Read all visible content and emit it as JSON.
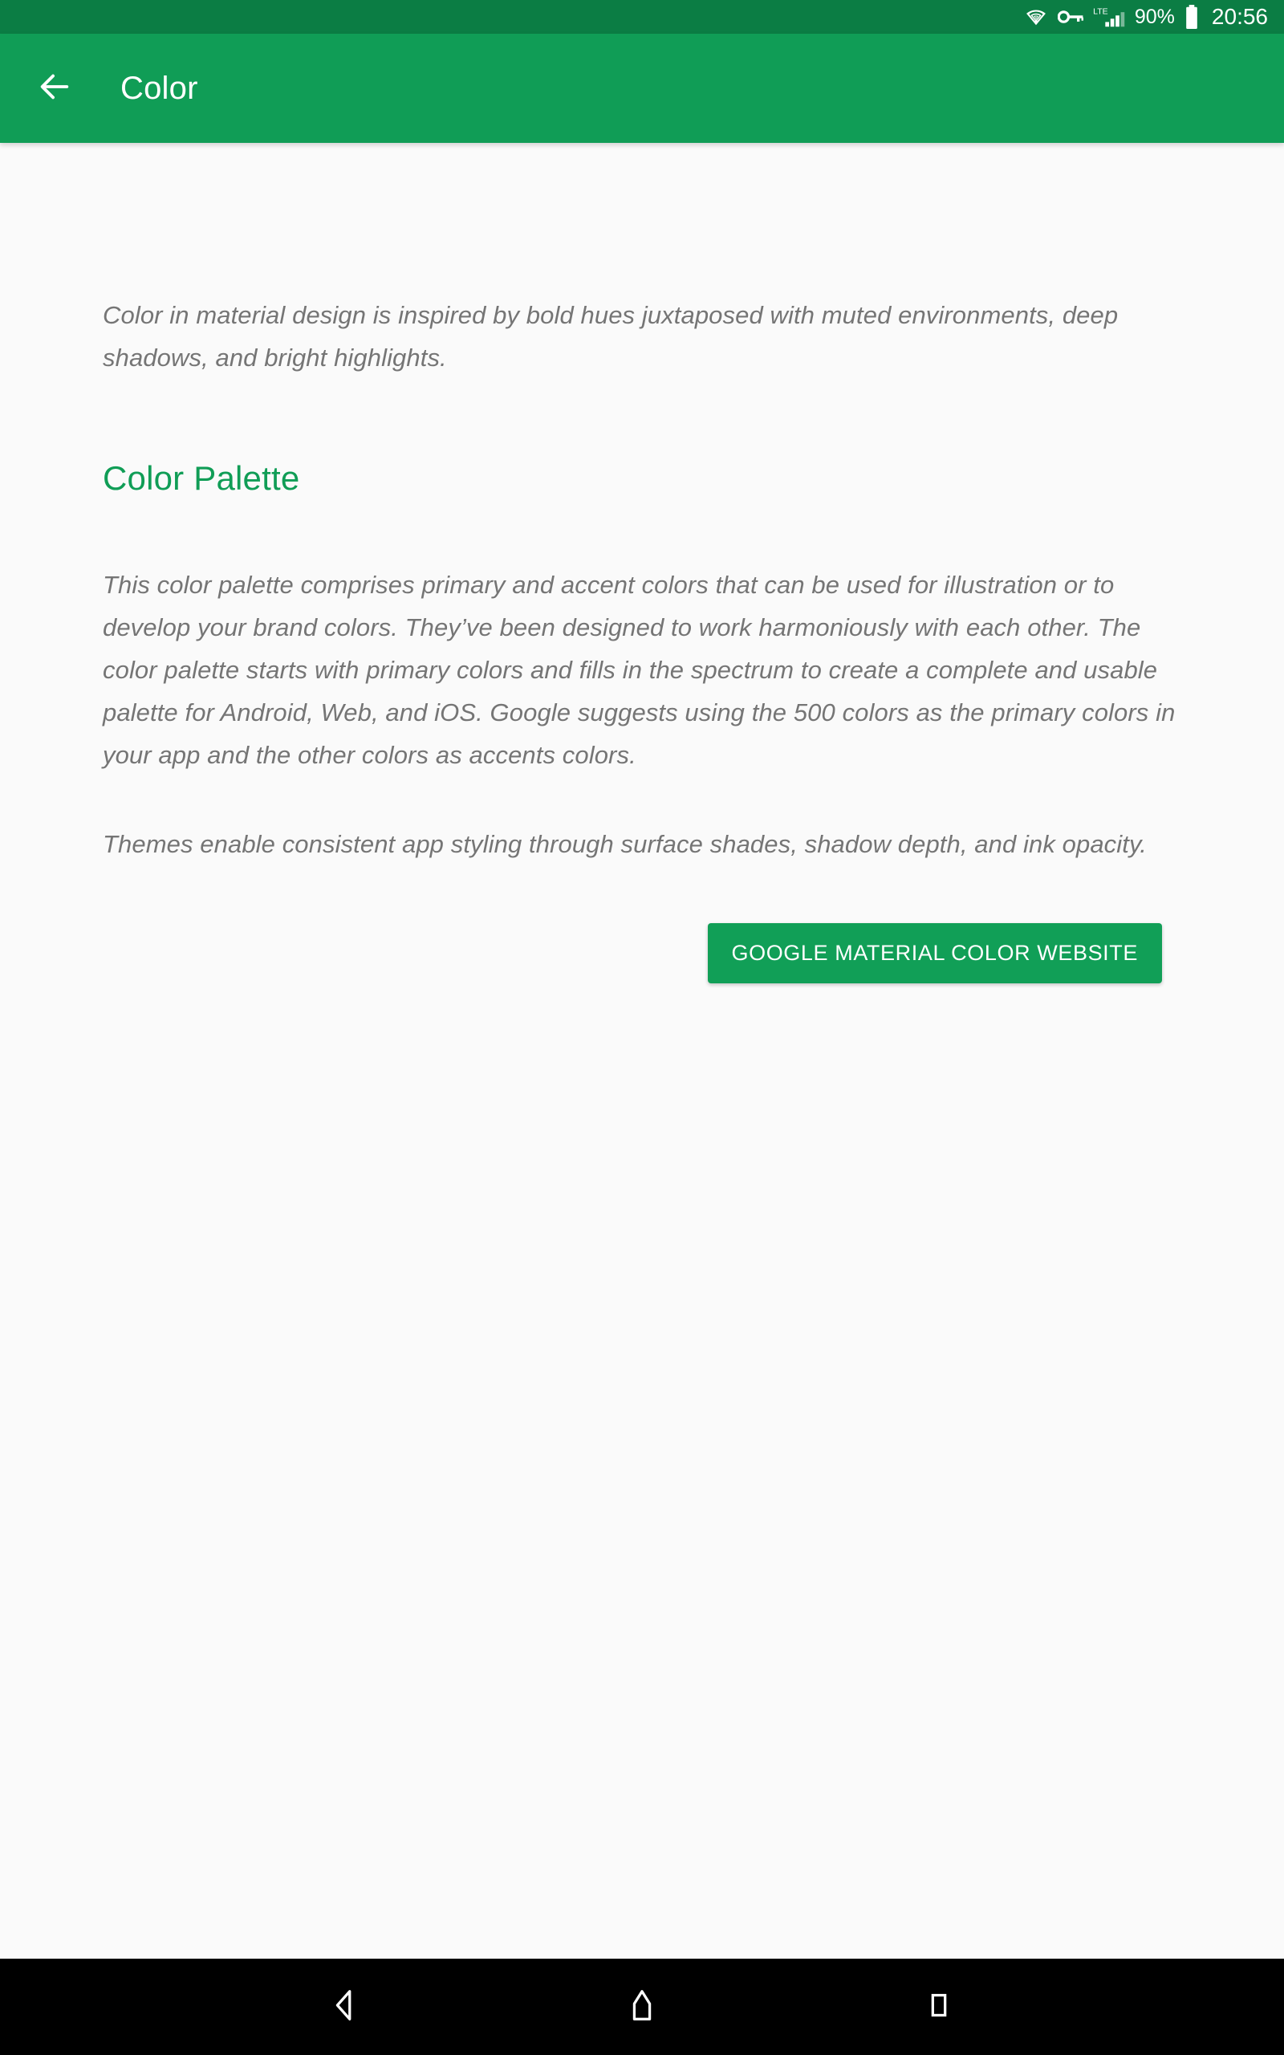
{
  "status_bar": {
    "icons": [
      "wifi-icon",
      "vpn-key-icon",
      "lte-signal-icon"
    ],
    "network_type": "LTE",
    "battery_percent": "90%",
    "battery_icon": "battery-full-icon",
    "time": "20:56",
    "background_color": "#0B7D44"
  },
  "app_bar": {
    "back_icon": "arrow-back-icon",
    "title": "Color",
    "background_color": "#109D56",
    "text_color": "#FFFFFF"
  },
  "content": {
    "intro_paragraph": "Color in material design is inspired by bold hues juxtaposed with muted environments, deep shadows, and bright highlights.",
    "section_heading": "Color Palette",
    "section_heading_color": "#109D56",
    "body_paragraph": "This color palette comprises primary and accent colors that can be used for illustration or to develop your brand colors. They’ve been designed to work harmoniously with each other. The color palette starts with primary colors and fills in the spectrum to create a complete and usable palette for Android, Web, and iOS. Google suggests using the 500 colors as the primary colors in your app and the other colors as accents colors.",
    "themes_paragraph": "Themes enable consistent app styling through surface shades, shadow depth, and ink opacity.",
    "body_text_color": "#757575",
    "background_color": "#FAFAFA"
  },
  "cta": {
    "label": "GOOGLE MATERIAL COLOR WEBSITE",
    "background_color": "#119F57",
    "text_color": "#FFFFFF"
  },
  "nav_bar": {
    "background_color": "#000000",
    "buttons": [
      {
        "name": "back",
        "icon": "nav-back-triangle-icon"
      },
      {
        "name": "home",
        "icon": "nav-home-icon"
      },
      {
        "name": "recents",
        "icon": "nav-recents-square-icon"
      }
    ]
  }
}
